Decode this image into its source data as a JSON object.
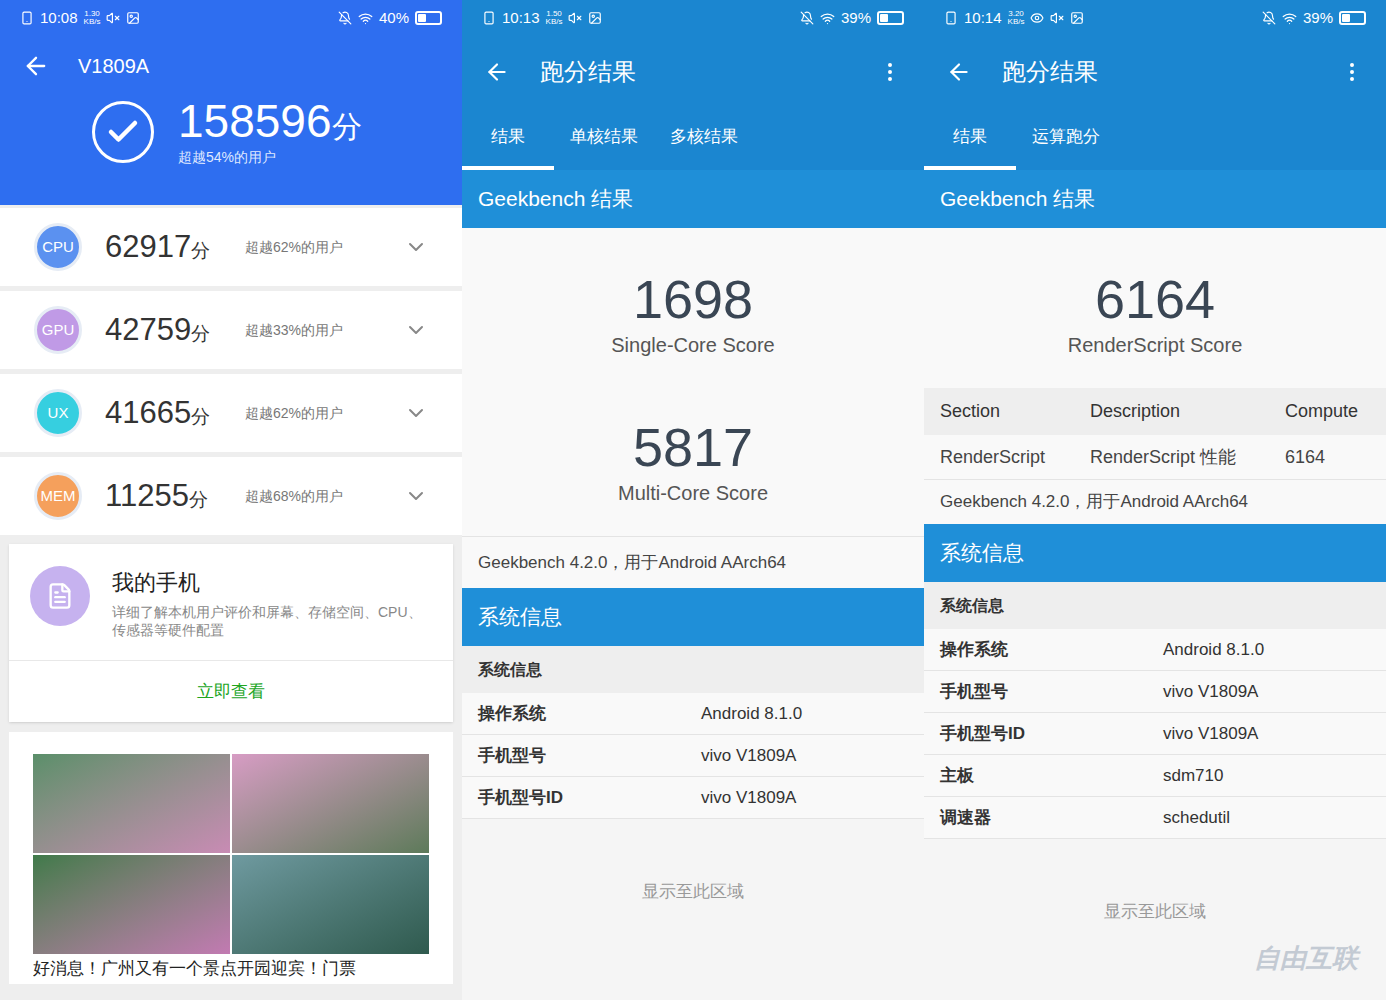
{
  "antutu": {
    "status_bar": {
      "time": "10:08",
      "speed": "1.30",
      "speed_unit": "KB/s",
      "battery": "40%",
      "battery_level": 0.4
    },
    "title": "V1809A",
    "total": {
      "score": "158596",
      "unit": "分",
      "rank": "超越54%的用户"
    },
    "categories": [
      {
        "label": "CPU",
        "score": "62917",
        "unit": "分",
        "rank": "超越62%的用户",
        "color": "#5b91f0"
      },
      {
        "label": "GPU",
        "score": "42759",
        "unit": "分",
        "rank": "超越33%的用户",
        "color": "#c09ae6"
      },
      {
        "label": "UX",
        "score": "41665",
        "unit": "分",
        "rank": "超越62%的用户",
        "color": "#36cfe0"
      },
      {
        "label": "MEM",
        "score": "11255",
        "unit": "分",
        "rank": "超越68%的用户",
        "color": "#f5a05c"
      }
    ],
    "my_phone": {
      "title": "我的手机",
      "description": "详细了解本机用户评价和屏幕、存储空间、CPU、传感器等硬件配置",
      "action": "立即查看"
    },
    "ad": {
      "caption": "好消息！广州又有一个景点开园迎宾！门票"
    }
  },
  "geekbench_cpu": {
    "status_bar": {
      "time": "10:13",
      "speed": "1.50",
      "speed_unit": "KB/s",
      "battery": "39%",
      "battery_level": 0.39
    },
    "title": "跑分结果",
    "tabs": [
      {
        "label": "结果",
        "selected": true
      },
      {
        "label": "单核结果",
        "selected": false
      },
      {
        "label": "多核结果",
        "selected": false
      }
    ],
    "section_title": "Geekbench 结果",
    "scores": [
      {
        "value": "1698",
        "label": "Single-Core Score"
      },
      {
        "value": "5817",
        "label": "Multi-Core Score"
      }
    ],
    "version": "Geekbench 4.2.0，用于Android AArch64",
    "sysinfo_title": "系统信息",
    "sysinfo_subtitle": "系统信息",
    "sysinfo": [
      {
        "key": "操作系统",
        "value": "Android 8.1.0"
      },
      {
        "key": "手机型号",
        "value": "vivo V1809A"
      },
      {
        "key": "手机型号ID",
        "value": "vivo V1809A"
      }
    ],
    "footer": "显示至此区域"
  },
  "geekbench_compute": {
    "status_bar": {
      "time": "10:14",
      "speed": "3.20",
      "speed_unit": "KB/s",
      "battery": "39%",
      "battery_level": 0.39
    },
    "title": "跑分结果",
    "tabs": [
      {
        "label": "结果",
        "selected": true
      },
      {
        "label": "运算跑分",
        "selected": false
      }
    ],
    "section_title": "Geekbench 结果",
    "scores": [
      {
        "value": "6164",
        "label": "RenderScript Score"
      }
    ],
    "table": {
      "columns": [
        "Section",
        "Description",
        "Compute"
      ],
      "rows": [
        [
          "RenderScript",
          "RenderScript 性能",
          "6164"
        ]
      ]
    },
    "version": "Geekbench 4.2.0，用于Android AArch64",
    "sysinfo_title": "系统信息",
    "sysinfo_subtitle": "系统信息",
    "sysinfo": [
      {
        "key": "操作系统",
        "value": "Android 8.1.0"
      },
      {
        "key": "手机型号",
        "value": "vivo V1809A"
      },
      {
        "key": "手机型号ID",
        "value": "vivo V1809A"
      },
      {
        "key": "主板",
        "value": "sdm710"
      },
      {
        "key": "调速器",
        "value": "schedutil"
      }
    ],
    "footer": "显示至此区域"
  },
  "watermark": "自由互联"
}
